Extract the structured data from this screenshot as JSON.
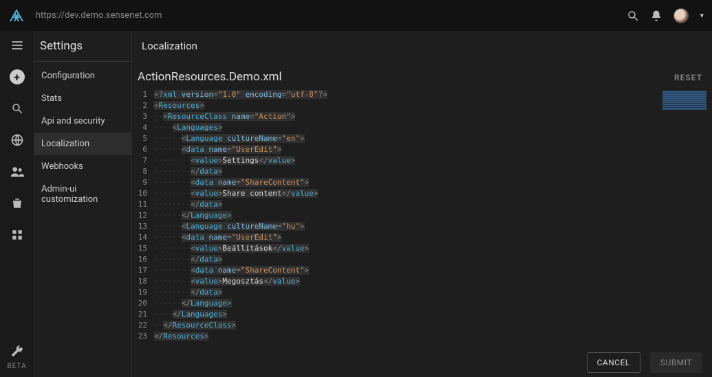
{
  "topbar": {
    "url": "https://dev.demo.sensenet.com"
  },
  "rail": {
    "beta_label": "BETA"
  },
  "sidebar": {
    "title": "Settings",
    "items": [
      {
        "label": "Configuration"
      },
      {
        "label": "Stats"
      },
      {
        "label": "Api and security"
      },
      {
        "label": "Localization",
        "active": true
      },
      {
        "label": "Webhooks"
      },
      {
        "label": "Admin-ui customization"
      }
    ]
  },
  "content": {
    "title": "Localization",
    "file_name": "ActionResources.Demo.xml",
    "reset_label": "RESET",
    "cancel_label": "CANCEL",
    "submit_label": "SUBMIT"
  },
  "editor": {
    "line_numbers": [
      "1",
      "2",
      "3",
      "4",
      "5",
      "6",
      "7",
      "8",
      "9",
      "10",
      "11",
      "12",
      "13",
      "14",
      "15",
      "16",
      "17",
      "18",
      "19",
      "20",
      "21",
      "22",
      "23"
    ],
    "xml": {
      "version": "1.0",
      "encoding": "utf-8",
      "root": "Resources",
      "resource_class_name": "Action",
      "languages": [
        {
          "cultureName": "en",
          "data": [
            {
              "name": "UserEdit",
              "value": "Settings"
            },
            {
              "name": "ShareContent",
              "value": "Share content"
            }
          ]
        },
        {
          "cultureName": "hu",
          "data": [
            {
              "name": "UserEdit",
              "value": "Beállítások"
            },
            {
              "name": "ShareContent",
              "value": "Megosztás"
            }
          ]
        }
      ]
    }
  }
}
